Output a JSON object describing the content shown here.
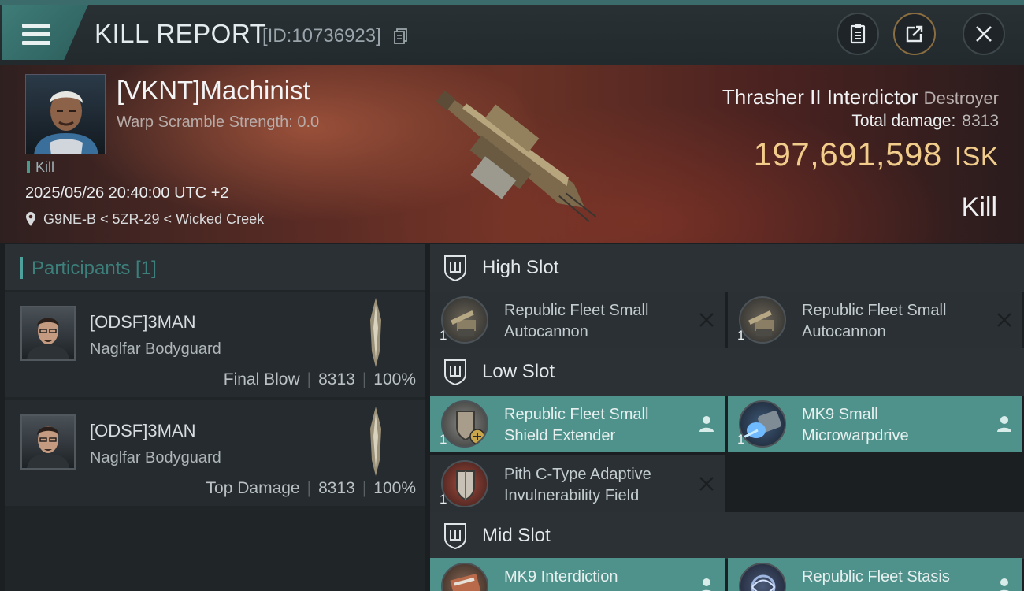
{
  "header": {
    "title": "KILL REPORT",
    "report_id": "[ID:10736923]",
    "icons": [
      "menu-icon",
      "copy-icon",
      "clipboard-icon",
      "share-icon",
      "close-icon"
    ]
  },
  "victim": {
    "name": "[VKNT]Machinist",
    "warp_scramble": "Warp Scramble Strength: 0.0",
    "tag": "Kill",
    "datetime": "2025/05/26 20:40:00 UTC +2",
    "location": "G9NE-B < 5ZR-29 < Wicked Creek",
    "ship_name": "Thrasher II Interdictor",
    "ship_class": "Destroyer",
    "total_damage_label": "Total damage:",
    "total_damage": "8313",
    "isk_value": "197,691,598",
    "isk_unit": "ISK",
    "result": "Kill"
  },
  "participants": {
    "title": "Participants [1]",
    "items": [
      {
        "name": "[ODSF]3MAN",
        "ship": "Naglfar Bodyguard",
        "role": "Final Blow",
        "damage": "8313",
        "percent": "100%"
      },
      {
        "name": "[ODSF]3MAN",
        "ship": "Naglfar Bodyguard",
        "role": "Top Damage",
        "damage": "8313",
        "percent": "100%"
      }
    ]
  },
  "slots": {
    "high": {
      "title": "High Slot",
      "modules": [
        {
          "qty": "1",
          "name1": "Republic Fleet Small",
          "name2": "Autocannon",
          "state": "destroyed"
        },
        {
          "qty": "1",
          "name1": "Republic Fleet Small",
          "name2": "Autocannon",
          "state": "destroyed"
        }
      ]
    },
    "low": {
      "title": "Low Slot",
      "modules": [
        {
          "qty": "1",
          "name1": "Republic Fleet Small",
          "name2": "Shield Extender",
          "state": "dropped"
        },
        {
          "qty": "1",
          "name1": "MK9 Small",
          "name2": "Microwarpdrive",
          "state": "dropped"
        },
        {
          "qty": "1",
          "name1": "Pith C-Type Adaptive",
          "name2": "Invulnerability Field",
          "state": "destroyed"
        }
      ]
    },
    "mid": {
      "title": "Mid Slot",
      "modules": [
        {
          "qty": "1",
          "name1": "MK9 Interdiction",
          "name2": "",
          "state": "dropped"
        },
        {
          "qty": "1",
          "name1": "Republic Fleet Stasis",
          "name2": "",
          "state": "dropped"
        }
      ]
    }
  },
  "colors": {
    "accent_teal": "#4f928c",
    "isk_gold": "#f1cc8a",
    "banner_red": "#5a2b24"
  }
}
